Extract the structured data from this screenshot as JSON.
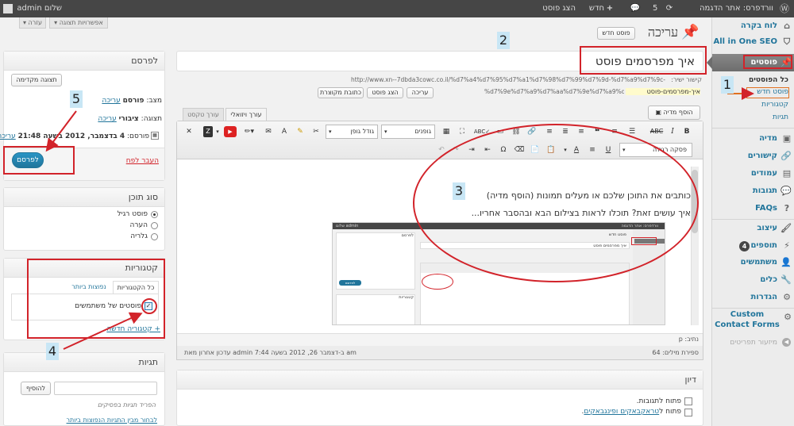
{
  "adminbar": {
    "site": "וורדפרס: אתר הדגמה",
    "updates": "5",
    "new": "חדש",
    "view_post": "הצג פוסט",
    "greeting": "שלום admin"
  },
  "menu": {
    "dashboard": "לוח בקרה",
    "seo": "All in One SEO",
    "posts": "פוסטים",
    "all_posts": "כל הפוסטים",
    "new_post": "פוסט חדש",
    "categories": "קטגוריות",
    "tags": "תגיות",
    "media": "מדיה",
    "links": "קישורים",
    "pages": "עמודים",
    "comments": "תגובות",
    "faqs": "FAQs",
    "appearance": "עיצוב",
    "plugins": "תוספים",
    "plugins_badge": "4",
    "users": "משתמשים",
    "tools": "כלים",
    "settings": "הגדרות",
    "contact": "Custom Contact Forms",
    "collapse": "מיזעור תפריטים"
  },
  "screen": {
    "options": "אפשרויות תצוגה",
    "help": "עזרה"
  },
  "page": {
    "title": "עריכה",
    "add_new": "פוסט חדש",
    "post_title": "איך מפרסמים פוסט",
    "permalink_label": "קישור ישיר:",
    "permalink_url": "http://www.xn--7dbda3cowc.co.il/%d7%a4%d7%95%d7%a1%d7%98%d7%99%d7%9d-%d7%a9%d7%9c-",
    "permalink_slug": "איך-מפרסמים-פוסט",
    "permalink_tail": "%d7%9e%d7%a9%d7%aa%d7%9e%d7%a9%d7%99%d7%9d/",
    "edit_btn": "עריכה",
    "view_btn": "הצג פוסט",
    "short_link": "כתובת מקוצרת",
    "add_media": "הוסף מדיה",
    "tab_visual": "עורך ויזואלי",
    "tab_text": "עורך טקסט",
    "font_family": "גופנים",
    "font_size": "גודל גופן",
    "paragraph": "פסקה רגילה",
    "line1": "כותבים את התוכן שלכם או מעלים תמונות (הוסף מדיה)",
    "line2": "איך עושים זאת? תוכלו לראות בצילום הבא ובהסבר אחריו...",
    "path": "נתיב: p",
    "word_count": "ספירת מילים: 64",
    "last_edit": "עדכון אחרון מאת admin ב-דצמבר 26, 2012 בשעה 7:44 am"
  },
  "discussion": {
    "title": "דיון",
    "allow_comments": "פתוח לתגובות.",
    "allow_trackbacks_pre": "פתוח ל",
    "allow_trackbacks_link": "טראקבאקים ופינגבאקים",
    "allow_trackbacks_post": "."
  },
  "publish": {
    "title": "לפרסם",
    "preview": "תצוגה מקדימה",
    "status_label": "מצב:",
    "status_value": "פורסם",
    "edit": "עריכה",
    "visibility_label": "תצוגה:",
    "visibility_value": "ציבורי",
    "published_label": "פורסם:",
    "published_value": "4 בדצמבר, 2012 בשעה 21:48",
    "trash": "העבר לפח",
    "publish_btn": "לפרסם"
  },
  "format": {
    "title": "סוג תוכן",
    "options": [
      "פוסט רגיל",
      "הערה",
      "גלריה"
    ]
  },
  "categories": {
    "title": "קטגוריות",
    "tab_all": "כל הקטגוריות",
    "tab_popular": "נפוצות ביותר",
    "item": "פוסטים של משתמשים",
    "add_new": "+ קטגוריה חדשה"
  },
  "tags": {
    "title": "תגיות",
    "add_btn": "להוסיף",
    "hint": "הפריד תגיות בפסיקים",
    "choose": "לבחור מבין התגיות הנפוצות ביותר"
  },
  "annotations": [
    "1",
    "2",
    "3",
    "4",
    "5"
  ],
  "thumb": {
    "greeting": "שלום admin",
    "site": "וורדפרס: אתר הדגמה",
    "title": "פוסט חדש",
    "post_title": "איך מפרסמים פוסט",
    "publish_title": "לפרסם",
    "publish_btn": "לפרסם",
    "categories": "קטגוריות"
  },
  "colors": {
    "accent": "#21759b",
    "annotation": "#d2232a",
    "adminbar": "#464646"
  }
}
